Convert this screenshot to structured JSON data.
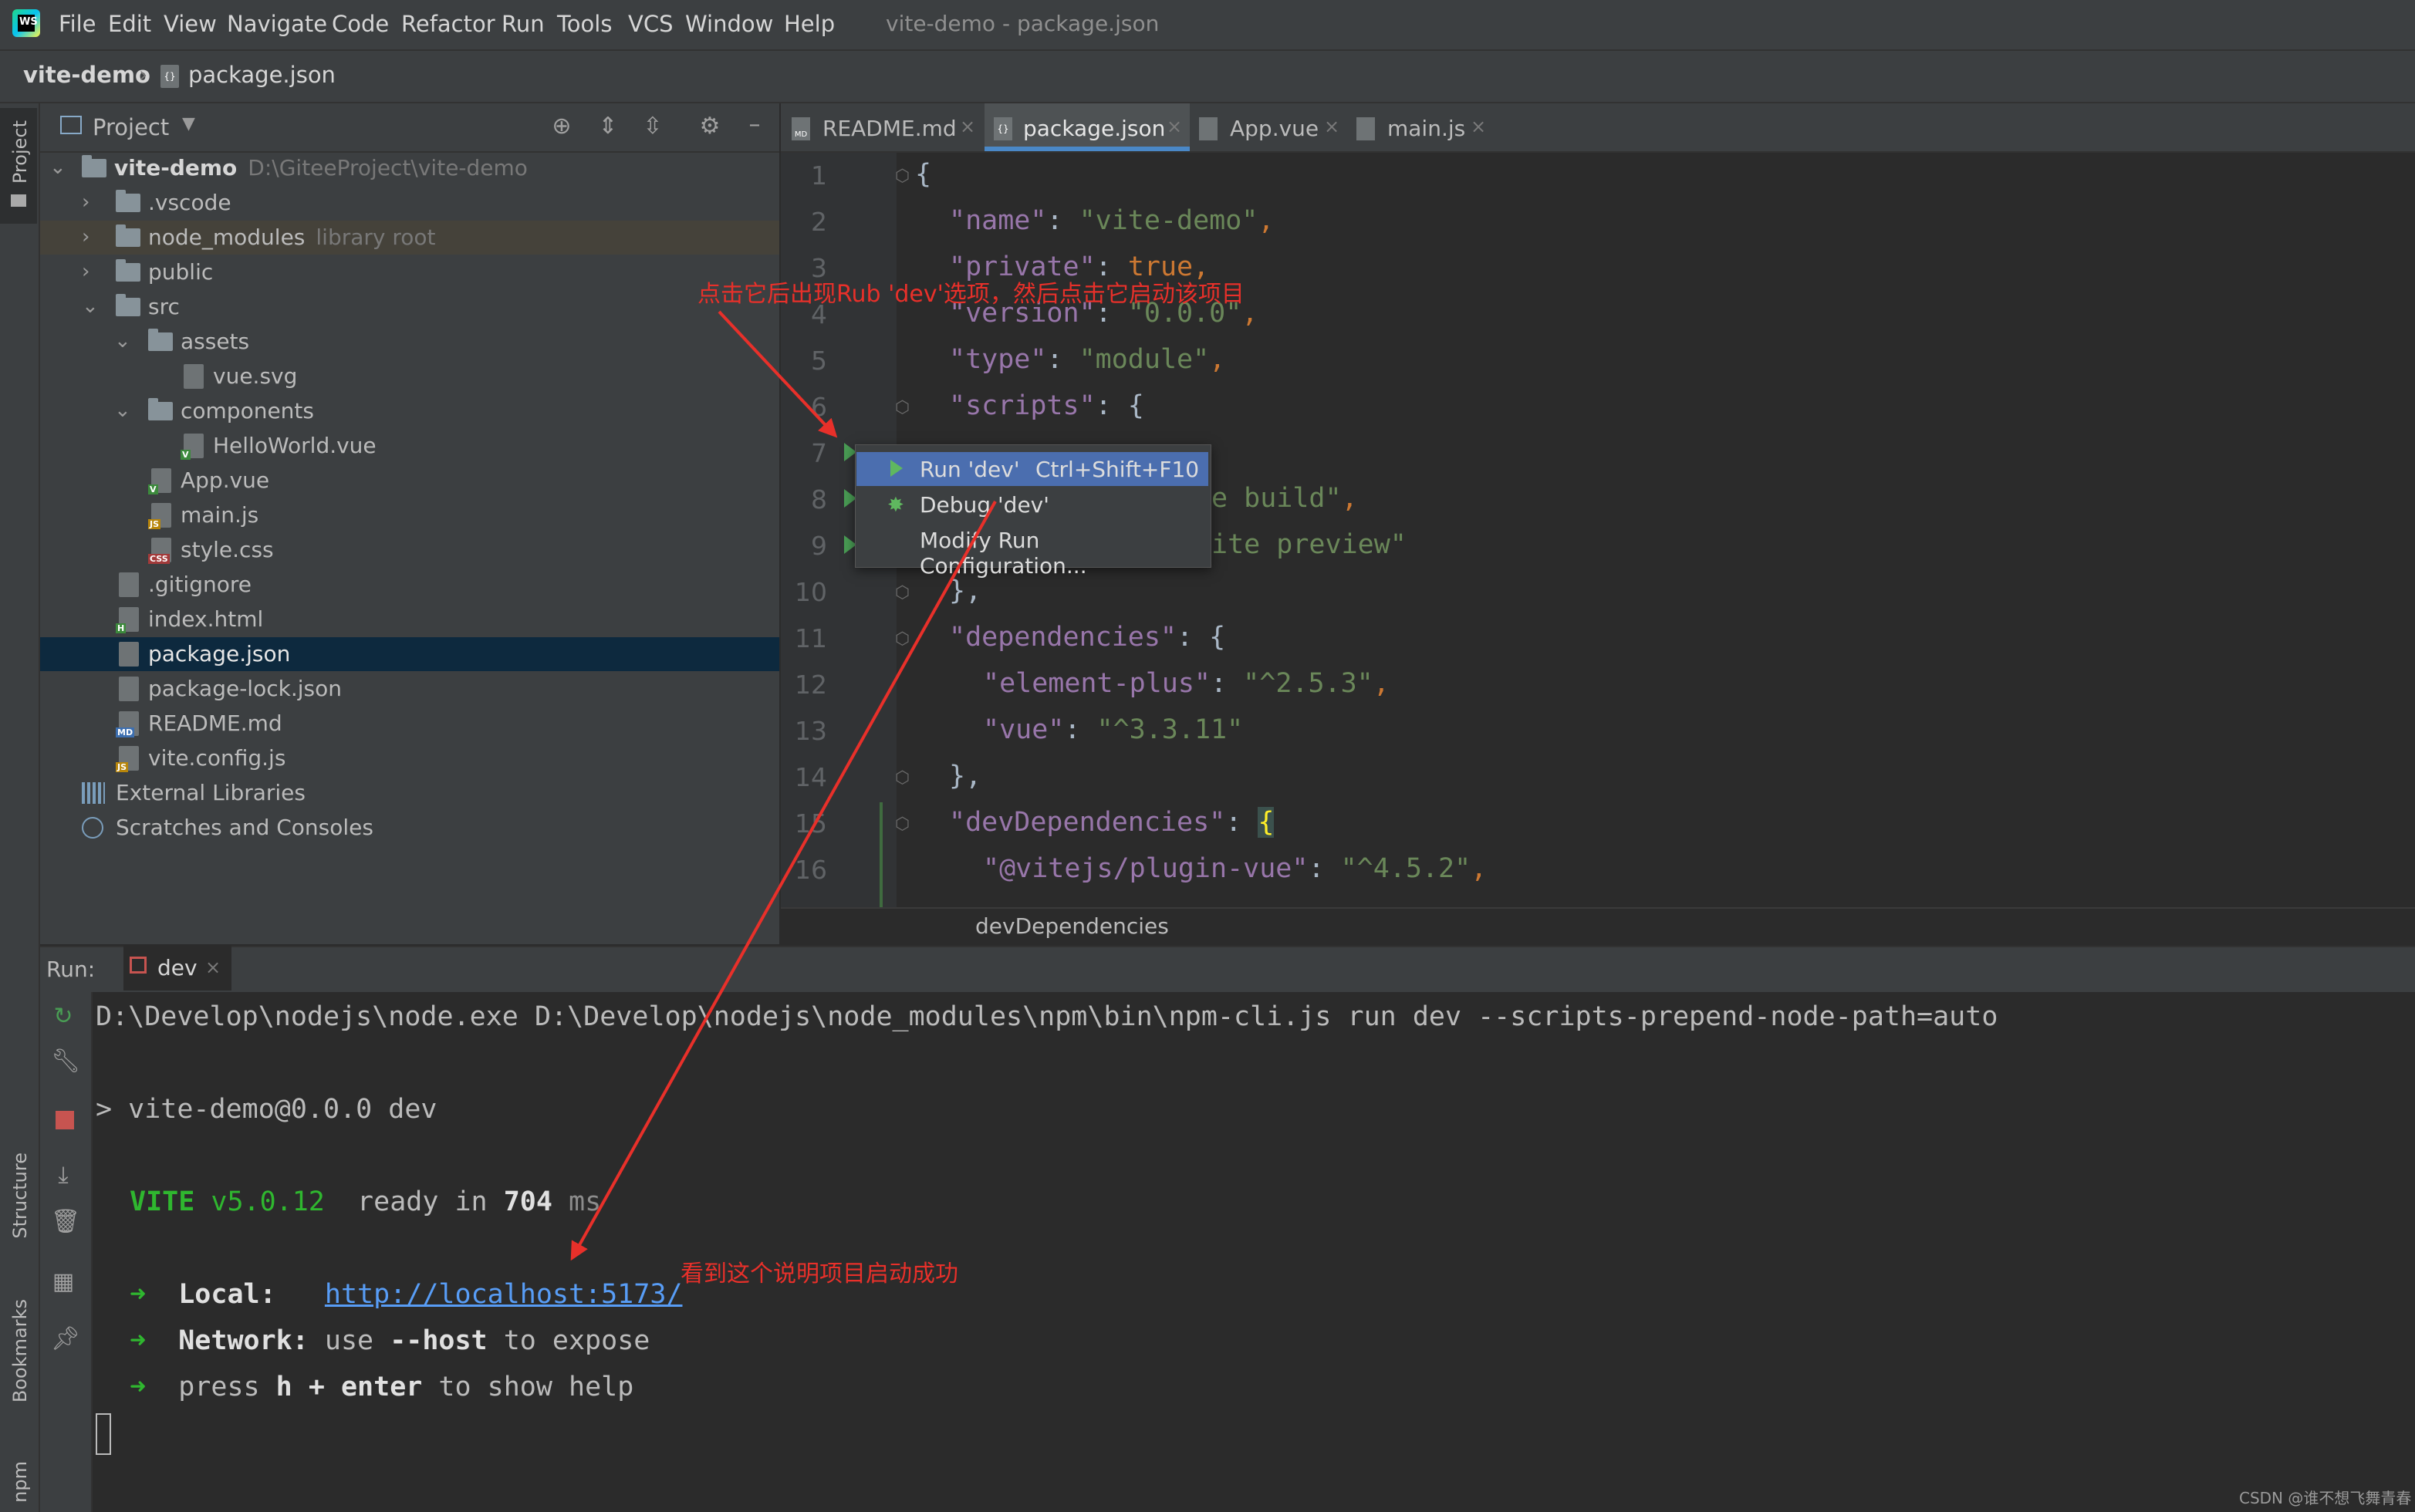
{
  "window_title": "vite-demo - package.json",
  "menu": [
    "File",
    "Edit",
    "View",
    "Navigate",
    "Code",
    "Refactor",
    "Run",
    "Tools",
    "VCS",
    "Window",
    "Help"
  ],
  "breadcrumbs": {
    "project": "vite-demo",
    "file": "package.json"
  },
  "left_strip": {
    "project": "Project",
    "structure": "Structure",
    "bookmarks": "Bookmarks",
    "npm": "npm"
  },
  "project_panel": {
    "title": "Project",
    "tree": [
      {
        "label": "vite-demo",
        "hint": "D:\\GiteeProject\\vite-demo",
        "type": "folder"
      },
      {
        "label": ".vscode",
        "type": "folder"
      },
      {
        "label": "node_modules",
        "hint": "library root",
        "type": "folder"
      },
      {
        "label": "public",
        "type": "folder"
      },
      {
        "label": "src",
        "type": "folder"
      },
      {
        "label": "assets",
        "type": "folder"
      },
      {
        "label": "vue.svg",
        "type": "svg"
      },
      {
        "label": "components",
        "type": "folder"
      },
      {
        "label": "HelloWorld.vue",
        "type": "vue"
      },
      {
        "label": "App.vue",
        "type": "vue"
      },
      {
        "label": "main.js",
        "type": "js"
      },
      {
        "label": "style.css",
        "type": "css"
      },
      {
        "label": ".gitignore",
        "type": "file"
      },
      {
        "label": "index.html",
        "type": "html"
      },
      {
        "label": "package.json",
        "type": "json"
      },
      {
        "label": "package-lock.json",
        "type": "json"
      },
      {
        "label": "README.md",
        "type": "md"
      },
      {
        "label": "vite.config.js",
        "type": "js"
      },
      {
        "label": "External Libraries",
        "type": "lib"
      },
      {
        "label": "Scratches and Consoles",
        "type": "scratch"
      }
    ]
  },
  "tabs": [
    {
      "label": "README.md",
      "badge": "MD"
    },
    {
      "label": "package.json",
      "badge": "{}"
    },
    {
      "label": "App.vue",
      "badge": "V"
    },
    {
      "label": "main.js",
      "badge": "JS"
    }
  ],
  "line_numbers": [
    "1",
    "2",
    "3",
    "4",
    "5",
    "6",
    "7",
    "8",
    "9",
    "10",
    "11",
    "12",
    "13",
    "14",
    "15",
    "16"
  ],
  "code": {
    "l1": "{",
    "name_key": "\"name\"",
    "name_val": "\"vite-demo\"",
    "private_key": "\"private\"",
    "private_val": "true",
    "version_key": "\"version\"",
    "version_val": "\"0.0.0\"",
    "type_key": "\"type\"",
    "type_val": "\"module\"",
    "scripts_key": "\"scripts\"",
    "l8_tail": "e build\"",
    "l9_tail": "ite preview\"",
    "l10": "},",
    "deps_key": "\"dependencies\"",
    "ep_key": "\"element-plus\"",
    "ep_val": "\"^2.5.3\"",
    "vue_key": "\"vue\"",
    "vue_val": "\"^3.3.11\"",
    "l14": "},",
    "devdeps_key": "\"devDependencies\"",
    "plugin_key": "\"@vitejs/plugin-vue\"",
    "plugin_val": "\"^4.5.2\""
  },
  "editor_breadcrumb": "devDependencies",
  "popup": {
    "run_label": "Run 'dev'",
    "run_shortcut": "Ctrl+Shift+F10",
    "debug_label": "Debug 'dev'",
    "modify_label": "Modify Run Configuration..."
  },
  "run_panel": {
    "label": "Run:",
    "tab": "dev"
  },
  "console": {
    "cmd": "D:\\Develop\\nodejs\\node.exe D:\\Develop\\nodejs\\node_modules\\npm\\bin\\npm-cli.js run dev --scripts-prepend-node-path=auto",
    "script_line": "> vite-demo@0.0.0 dev",
    "vite": "VITE",
    "version": "v5.0.12",
    "ready_a": "ready in",
    "ready_ms": "704",
    "ready_b": "ms",
    "local_label": "Local:",
    "local_url": "http://localhost:5173/",
    "network_label": "Network:",
    "network_a": "use",
    "network_flag": "--host",
    "network_b": "to expose",
    "help_a": "press",
    "help_h": "h",
    "help_plus": "+",
    "help_enter": "enter",
    "help_b": "to show help",
    "arrow": "➜"
  },
  "annotations": {
    "top": "点击它后出现Rub 'dev'选项，然后点击它启动该项目",
    "bottom": "看到这个说明项目启动成功"
  },
  "watermark": "CSDN @谁不想飞舞青春",
  "colors": {
    "annotation": "#e8302a",
    "selection": "#4b6eaf",
    "vite_green": "#2fb72f",
    "link": "#589df6"
  }
}
